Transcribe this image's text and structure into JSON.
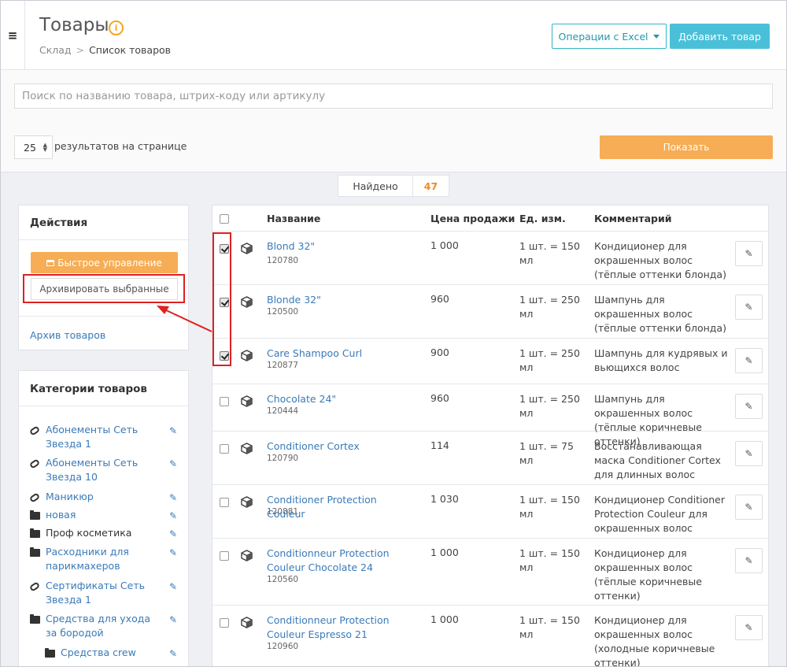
{
  "header": {
    "menu_icon": "hamburger-icon",
    "title": "Товары",
    "info_icon": "info-icon",
    "info_glyph": "i",
    "breadcrumb": {
      "root": "Склад",
      "separator": ">",
      "current": "Список товаров"
    },
    "excel_button": "Операции с Excel",
    "add_button": "Добавить товар"
  },
  "filters": {
    "search_placeholder": "Поиск по названию товара, штрих-коду или артикулу",
    "per_page_value": "25",
    "per_page_label": "результатов на странице",
    "show_button": "Показать"
  },
  "found": {
    "label": "Найдено",
    "count": "47"
  },
  "actions": {
    "title": "Действия",
    "quick_button": "Быстрое управление",
    "archive_button": "Архивировать выбранные",
    "archive_link": "Архив товаров"
  },
  "categories": {
    "title": "Категории товаров",
    "items": [
      {
        "label": "Абонементы Сеть Звезда 1",
        "icon": "link-icon"
      },
      {
        "label": "Абонементы Сеть Звезда 10",
        "icon": "link-icon"
      },
      {
        "label": "Маникюр",
        "icon": "link-icon"
      },
      {
        "label": "новая",
        "icon": "folder-icon"
      },
      {
        "label": "Проф косметика",
        "icon": "folder-icon"
      },
      {
        "label": "Расходники для парикмахеров",
        "icon": "folder-icon"
      },
      {
        "label": "Сертификаты Сеть Звезда 1",
        "icon": "link-icon"
      },
      {
        "label": "Средства для ухода за бородой",
        "icon": "folder-icon"
      },
      {
        "label": "Средства crew",
        "icon": "folder-icon"
      }
    ]
  },
  "table": {
    "headers": {
      "name": "Название",
      "price": "Цена продажи",
      "unit": "Ед. изм.",
      "comment": "Комментарий"
    },
    "rows": [
      {
        "checked": true,
        "name": "Blond 32\"",
        "code": "120780",
        "price": "1 000",
        "unit": "1 шт. = 150 мл",
        "comment": "Кондиционер для окрашенных волос (тёплые оттенки блонда)"
      },
      {
        "checked": true,
        "name": "Blonde 32\"",
        "code": "120500",
        "price": "960",
        "unit": "1 шт. = 250 мл",
        "comment": "Шампунь для окрашенных волос (тёплые оттенки блонда)"
      },
      {
        "checked": true,
        "name": "Care Shampoo Curl",
        "code": "120877",
        "price": "900",
        "unit": "1 шт. = 250 мл",
        "comment": "Шампунь для кудрявых и вьющихся волос"
      },
      {
        "checked": false,
        "name": "Chocolate 24\"",
        "code": "120444",
        "price": "960",
        "unit": "1 шт. = 250 мл",
        "comment": "Шампунь для окрашенных волос (тёплые коричневые оттенки)"
      },
      {
        "checked": false,
        "name": "Conditioner Cortex",
        "code": "120790",
        "price": "114",
        "unit": "1 шт. = 75 мл",
        "comment": "Восстанавливающая маска Conditioner Cortex для длинных волос"
      },
      {
        "checked": false,
        "name": "Conditioner Protection Couleur",
        "code": "120881",
        "price": "1 030",
        "unit": "1 шт. = 150 мл",
        "comment": "Кондиционер Conditioner Protection Couleur для окрашенных волос"
      },
      {
        "checked": false,
        "name": "Conditionneur Protection Couleur Chocolate 24",
        "code": "120560",
        "price": "1 000",
        "unit": "1 шт. = 150 мл",
        "comment": "Кондиционер для окрашенных волос (тёплые коричневые оттенки)"
      },
      {
        "checked": false,
        "name": "Conditionneur Protection Couleur Espresso 21",
        "code": "120960",
        "price": "1 000",
        "unit": "1 шт. = 150 мл",
        "comment": "Кондиционер для окрашенных волос (холодные коричневые оттенки)"
      }
    ]
  },
  "colors": {
    "accent": "#4ac0d8",
    "orange": "#f6ad55",
    "link": "#3a7ab8",
    "annotation": "#e02020"
  }
}
